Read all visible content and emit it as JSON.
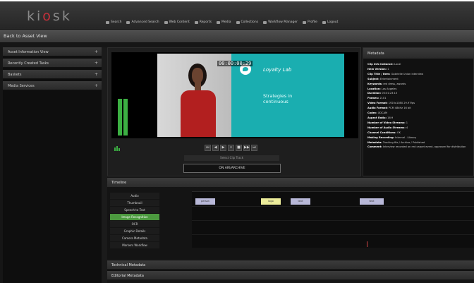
{
  "app": {
    "logo_pre": "ki",
    "logo_dot": "o",
    "logo_post": "sk",
    "title": "Back to Asset View"
  },
  "nav": [
    {
      "label": "Search",
      "icon": "search-icon"
    },
    {
      "label": "Advanced Search",
      "icon": "binoculars-icon"
    },
    {
      "label": "Web Content",
      "icon": "globe-icon"
    },
    {
      "label": "Reports",
      "icon": "report-icon"
    },
    {
      "label": "Media",
      "icon": "film-icon"
    },
    {
      "label": "Collections",
      "icon": "folder-icon"
    },
    {
      "label": "Workflow Manager",
      "icon": "workflow-icon"
    },
    {
      "label": "Profile",
      "icon": "user-icon"
    },
    {
      "label": "Logout",
      "icon": "logout-icon"
    }
  ],
  "left_panel": [
    {
      "label": "Asset Information View"
    },
    {
      "label": "Recently Created Tasks"
    },
    {
      "label": "Baskets"
    },
    {
      "label": "Media Services"
    }
  ],
  "player": {
    "timecode": "00:00:00:29",
    "brand": "Loyalty Lab",
    "overlay_text": "Strategies in continuous",
    "clip_label": "Select Clip Track",
    "state": "ON AIR/ARCHIVE",
    "controls": [
      "⏮",
      "◀",
      "▶",
      "⏸",
      "■",
      "▶▶",
      "⏭"
    ]
  },
  "metadata": {
    "title": "Metadata",
    "lines": [
      {
        "k": "Clip Info Instance:",
        "v": " Local"
      },
      {
        "k": "Item Version:",
        "v": " 1"
      },
      {
        "k": "Clip Title / Item:",
        "v": " Gabrielle Union interview"
      },
      {
        "k": "Subject:",
        "v": " Entertainment"
      },
      {
        "k": "Keywords:",
        "v": " red dress, awards"
      },
      {
        "k": "Location:",
        "v": " Los Angeles"
      },
      {
        "k": "Duration:",
        "v": " 00:01:23:15"
      },
      {
        "k": "Frames:",
        "v": " 2101"
      },
      {
        "k": "Video Format:",
        "v": " 1920x1080 29.97fps"
      },
      {
        "k": "Audio Format:",
        "v": " PCM 48kHz 16 bit"
      },
      {
        "k": "Codec:",
        "v": " XDCAM"
      },
      {
        "k": "Aspect Ratio:",
        "v": " 16:9"
      },
      {
        "k": "Number of Video Streams:",
        "v": " 1"
      },
      {
        "k": "Number of Audio Streams:",
        "v": " 4"
      },
      {
        "k": "Channel Conditions:",
        "v": " OK"
      },
      {
        "k": "Making Recording:",
        "v": " Internal - Library"
      },
      {
        "k": "Metadata:",
        "v": " Tracking file / Archive / Published"
      },
      {
        "k": "Comment:",
        "v": " Interview recorded on red carpet event, approved for distribution"
      }
    ]
  },
  "timeline": {
    "title": "Timeline",
    "tracks": [
      {
        "label": "Audio",
        "active": false
      },
      {
        "label": "Thumbnail",
        "active": false
      },
      {
        "label": "Speech to Text",
        "active": false
      },
      {
        "label": "Image Recognition",
        "active": true
      },
      {
        "label": "OCR",
        "active": false
      },
      {
        "label": "Graphic Details",
        "active": false
      },
      {
        "label": "Camera Metadata",
        "active": false
      },
      {
        "label": "Markers Workflow",
        "active": false
      }
    ],
    "clips": [
      {
        "label": "person",
        "color": "#b8b8d8"
      },
      {
        "label": "logo",
        "color": "#ecec9a"
      },
      {
        "label": "text",
        "color": "#b8b8d8"
      },
      {
        "label": "text",
        "color": "#b8b8d8"
      }
    ]
  },
  "sections": [
    {
      "label": "Technical Metadata"
    },
    {
      "label": "Editorial Metadata"
    }
  ]
}
